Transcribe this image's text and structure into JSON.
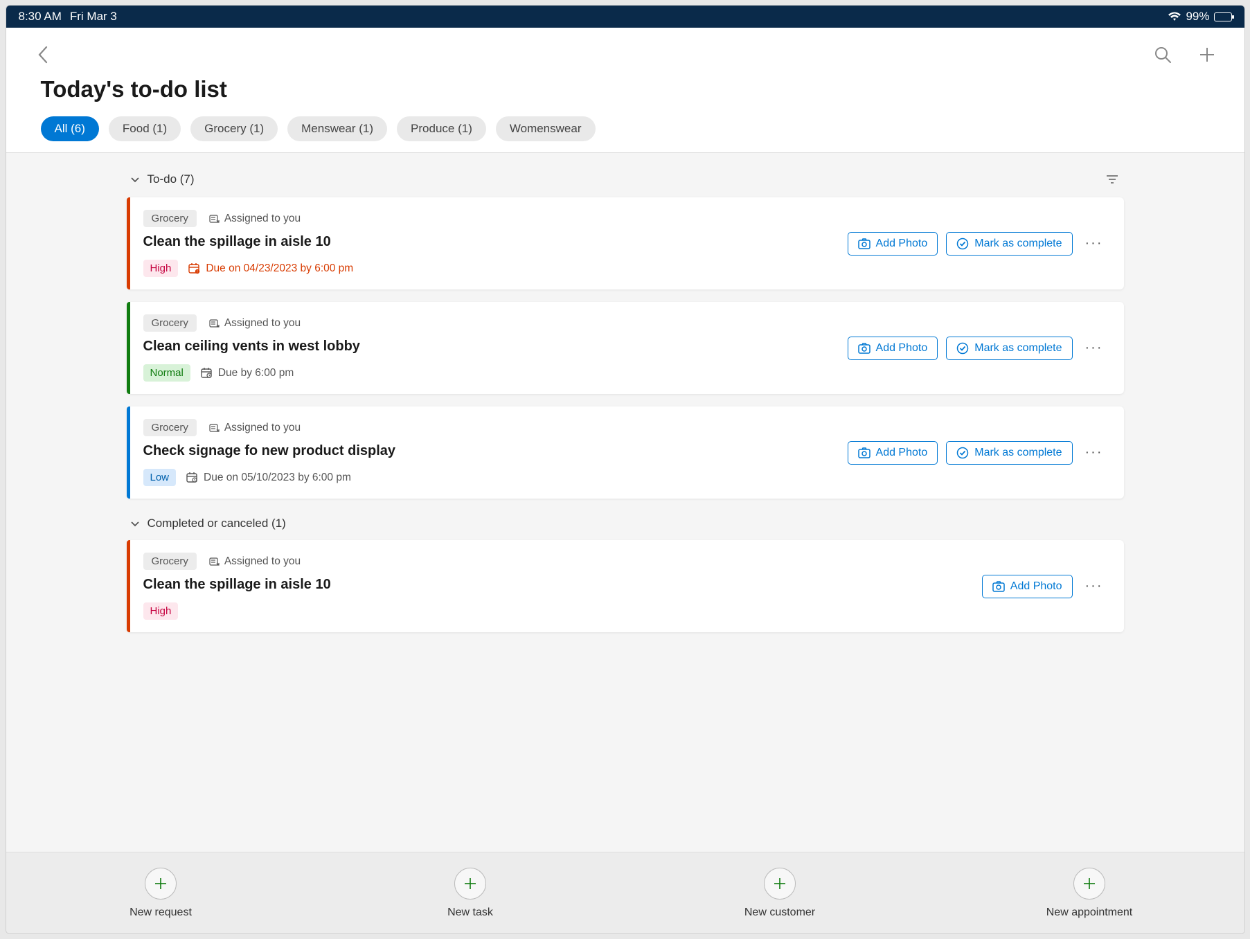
{
  "statusbar": {
    "time": "8:30 AM",
    "date": "Fri Mar 3",
    "battery": "99%"
  },
  "header": {
    "title": "Today's to-do list"
  },
  "filters": [
    {
      "label": "All (6)",
      "active": true
    },
    {
      "label": "Food (1)",
      "active": false
    },
    {
      "label": "Grocery (1)",
      "active": false
    },
    {
      "label": "Menswear (1)",
      "active": false
    },
    {
      "label": "Produce (1)",
      "active": false
    },
    {
      "label": "Womenswear",
      "active": false
    }
  ],
  "sections": {
    "todo": {
      "label": "To-do (7)"
    },
    "completed": {
      "label": "Completed or canceled (1)"
    }
  },
  "labels": {
    "assigned": "Assigned to you",
    "add_photo": "Add Photo",
    "mark_complete": "Mark as complete"
  },
  "tasks_todo": [
    {
      "category": "Grocery",
      "title": "Clean the spillage in aisle 10",
      "priority": "High",
      "priority_class": "prio-high",
      "stripe": "stripe-red",
      "due": "Due on 04/23/2023 by 6:00 pm",
      "due_style": "due-overdue",
      "show_complete": true
    },
    {
      "category": "Grocery",
      "title": "Clean ceiling vents in west lobby",
      "priority": "Normal",
      "priority_class": "prio-normal",
      "stripe": "stripe-green",
      "due": "Due by 6:00 pm",
      "due_style": "due-normal",
      "show_complete": true
    },
    {
      "category": "Grocery",
      "title": "Check signage fo new product display",
      "priority": "Low",
      "priority_class": "prio-low",
      "stripe": "stripe-blue",
      "due": "Due on 05/10/2023 by 6:00 pm",
      "due_style": "due-normal",
      "show_complete": true
    }
  ],
  "tasks_done": [
    {
      "category": "Grocery",
      "title": "Clean the spillage in aisle 10",
      "priority": "High",
      "priority_class": "prio-high",
      "stripe": "stripe-red",
      "show_complete": false
    }
  ],
  "bottom": [
    {
      "label": "New request"
    },
    {
      "label": "New task"
    },
    {
      "label": "New customer"
    },
    {
      "label": "New appointment"
    }
  ]
}
